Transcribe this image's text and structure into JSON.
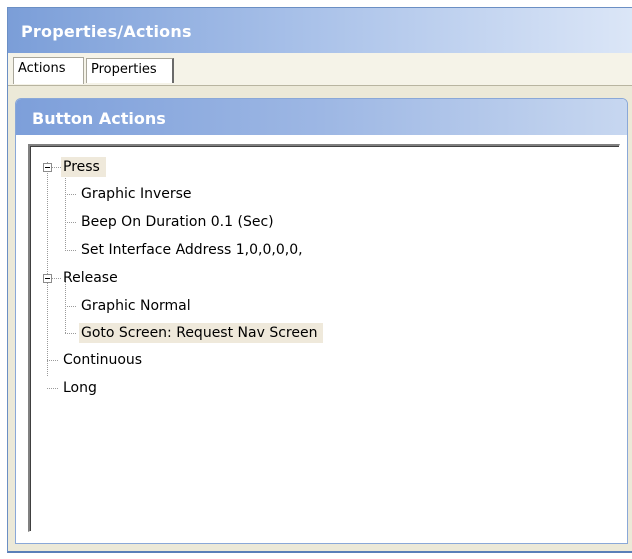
{
  "panel": {
    "title": "Properties/Actions"
  },
  "tabs": [
    {
      "label": "Actions",
      "active": true
    },
    {
      "label": "Properties",
      "active": false
    }
  ],
  "group": {
    "title": "Button Actions"
  },
  "tree": {
    "press": {
      "label": "Press",
      "expanded": true,
      "children": [
        {
          "label": "Graphic Inverse"
        },
        {
          "label": "Beep On  Duration  0.1 (Sec)"
        },
        {
          "label": "Set Interface Address 1,0,0,0,0,"
        }
      ]
    },
    "release": {
      "label": "Release",
      "expanded": true,
      "children": [
        {
          "label": "Graphic Normal"
        },
        {
          "label": "Goto Screen: Request Nav Screen"
        }
      ]
    },
    "continuous": {
      "label": "Continuous"
    },
    "long": {
      "label": "Long"
    }
  },
  "colors": {
    "title_gradient_start": "#7b9ed8",
    "selection": "#efe9db",
    "panel_bg": "#ece9d8"
  }
}
